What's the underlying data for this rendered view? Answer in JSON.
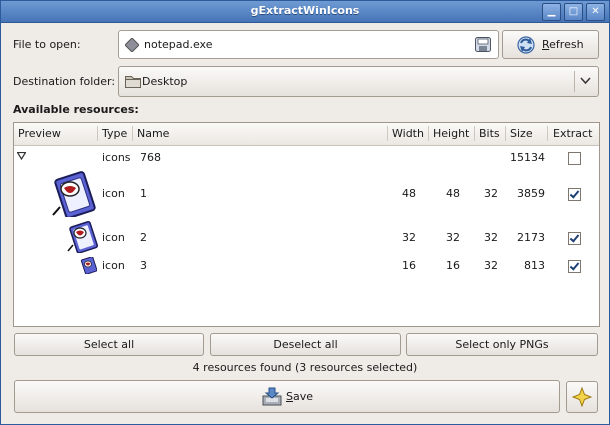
{
  "window": {
    "title": "gExtractWinIcons"
  },
  "titlebar_buttons": [
    "minimize-icon",
    "maximize-icon",
    "close-icon"
  ],
  "file": {
    "label": "File to open:",
    "value": "notepad.exe",
    "refresh_prefix": "",
    "refresh_underlined": "R",
    "refresh_rest": "efresh"
  },
  "destination": {
    "label": "Destination folder:",
    "value": "Desktop"
  },
  "resources": {
    "heading": "Available resources:",
    "columns": [
      "Preview",
      "Type",
      "Name",
      "Width",
      "Height",
      "Bits",
      "Size",
      "Extract"
    ],
    "rows": [
      {
        "type": "icons",
        "name": "768",
        "width": "",
        "height": "",
        "bits": "",
        "size": "15134",
        "extract": false
      },
      {
        "type": "icon",
        "name": "1",
        "width": "48",
        "height": "48",
        "bits": "32",
        "size": "3859",
        "extract": true
      },
      {
        "type": "icon",
        "name": "2",
        "width": "32",
        "height": "32",
        "bits": "32",
        "size": "2173",
        "extract": true
      },
      {
        "type": "icon",
        "name": "3",
        "width": "16",
        "height": "16",
        "bits": "32",
        "size": "813",
        "extract": true
      }
    ]
  },
  "buttons": {
    "select_all": "Select all",
    "deselect_all": "Deselect all",
    "select_pngs": "Select only PNGs"
  },
  "status": "4 resources found (3 resources selected)",
  "save": {
    "underlined": "S",
    "rest": "ave"
  },
  "colors": {
    "titlebar": "#5a86c8",
    "accent": "#1d3f73"
  }
}
